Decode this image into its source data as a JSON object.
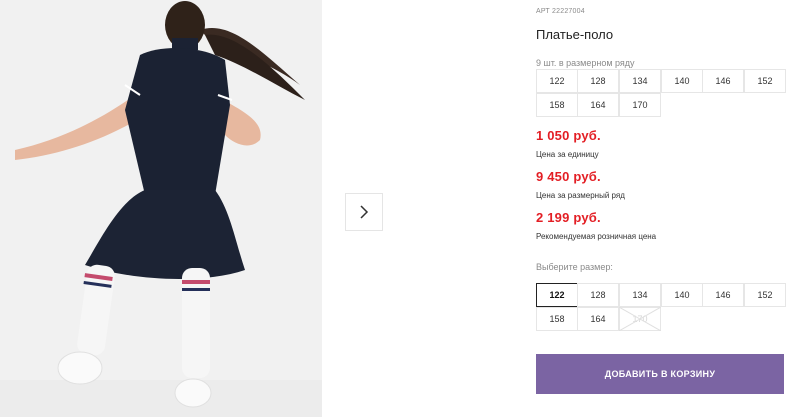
{
  "product": {
    "article": "АРТ 22227004",
    "title": "Платье-поло",
    "row_note": "9 шт. в размерном ряду",
    "size_row": [
      "122",
      "128",
      "134",
      "140",
      "146",
      "152",
      "158",
      "164",
      "170"
    ],
    "prices": [
      {
        "value": "1 050 руб.",
        "label": "Цена за единицу"
      },
      {
        "value": "9 450 руб.",
        "label": "Цена за размерный ряд"
      },
      {
        "value": "2 199 руб.",
        "label": "Рекомендуемая розничная цена"
      }
    ],
    "choose_label": "Выберите размер:",
    "sizes": [
      "122",
      "128",
      "134",
      "140",
      "146",
      "152",
      "158",
      "164",
      "170"
    ],
    "selected_size": "122",
    "unavailable_size": "170",
    "add_to_cart": "ДОБАВИТЬ В КОРЗИНУ"
  },
  "icons": {
    "next": "chevron-right-icon"
  },
  "colors": {
    "price": "#e31e24",
    "button": "#7b64a3",
    "dress": "#1b2233"
  }
}
